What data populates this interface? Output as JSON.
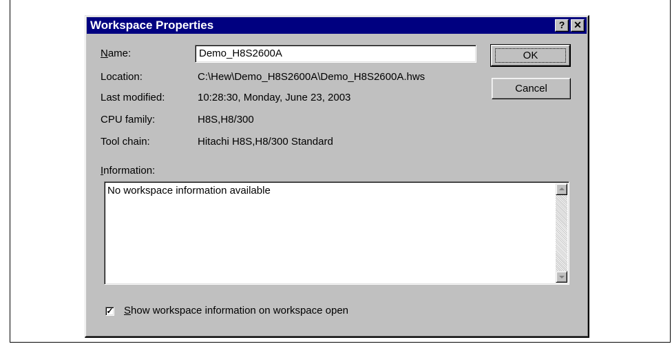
{
  "dialog": {
    "title": "Workspace Properties",
    "help_glyph": "?",
    "close_glyph": "✕"
  },
  "fields": {
    "name_label_key": "N",
    "name_label_rest": "ame:",
    "name_value": "Demo_H8S2600A",
    "location_label": "Location:",
    "location_value": "C:\\Hew\\Demo_H8S2600A\\Demo_H8S2600A.hws",
    "last_modified_label": "Last modified:",
    "last_modified_value": "10:28:30, Monday, June 23, 2003",
    "cpu_family_label": "CPU family:",
    "cpu_family_value": "H8S,H8/300",
    "tool_chain_label": "Tool chain:",
    "tool_chain_value": "Hitachi H8S,H8/300 Standard"
  },
  "buttons": {
    "ok": "OK",
    "cancel": "Cancel"
  },
  "information": {
    "label_key": "I",
    "label_rest": "nformation:",
    "text": "No workspace information available"
  },
  "checkbox": {
    "checked": true,
    "check_glyph": "✓",
    "label_key": "S",
    "label_rest": "how workspace information on workspace open"
  },
  "icons": [
    "help-icon",
    "close-icon",
    "scroll-up-icon",
    "scroll-down-icon",
    "checkmark-icon"
  ]
}
